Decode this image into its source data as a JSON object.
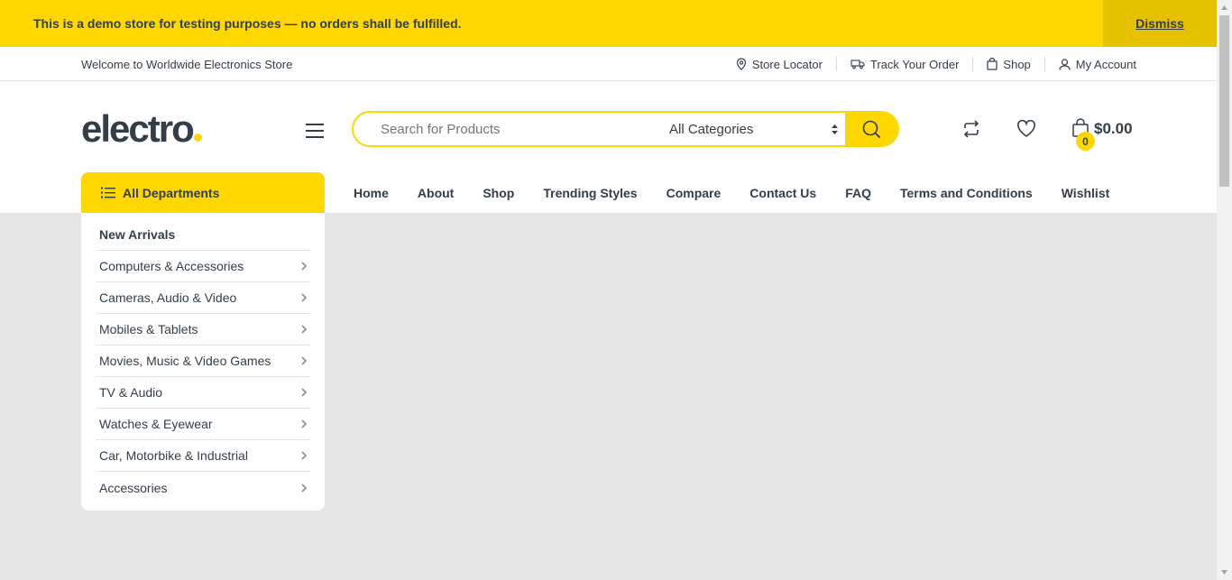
{
  "demo_notice": {
    "text": "This is a demo store for testing purposes — no orders shall be fulfilled.",
    "dismiss_label": "Dismiss"
  },
  "top_bar": {
    "welcome": "Welcome to Worldwide Electronics Store",
    "links": [
      {
        "label": "Store Locator",
        "icon": "map-pin-icon"
      },
      {
        "label": "Track Your Order",
        "icon": "truck-icon"
      },
      {
        "label": "Shop",
        "icon": "shopping-bag-icon"
      },
      {
        "label": "My Account",
        "icon": "user-icon"
      }
    ]
  },
  "header": {
    "logo": "electro",
    "search_placeholder": "Search for Products",
    "category_selected": "All Categories",
    "cart_total": "$0.00",
    "cart_count": "0"
  },
  "departments": {
    "button_label": "All Departments",
    "items": [
      {
        "label": "New Arrivals"
      },
      {
        "label": "Computers & Accessories"
      },
      {
        "label": "Cameras, Audio & Video"
      },
      {
        "label": "Mobiles & Tablets"
      },
      {
        "label": "Movies, Music & Video Games"
      },
      {
        "label": "TV & Audio"
      },
      {
        "label": "Watches & Eyewear"
      },
      {
        "label": "Car, Motorbike & Industrial"
      },
      {
        "label": "Accessories"
      }
    ]
  },
  "nav": {
    "items": [
      "Home",
      "About",
      "Shop",
      "Trending Styles",
      "Compare",
      "Contact Us",
      "FAQ",
      "Terms and Conditions",
      "Wishlist"
    ]
  },
  "colors": {
    "accent": "#fed700",
    "text": "#333e48",
    "background": "#e6e6e6"
  }
}
